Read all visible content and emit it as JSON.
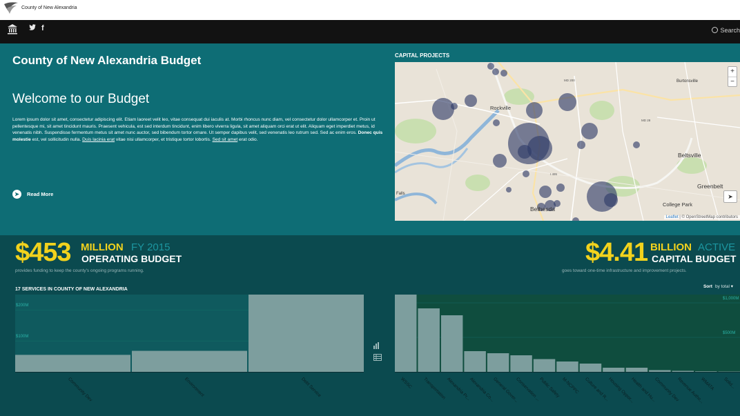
{
  "site": {
    "title": "County of New Alexandria"
  },
  "nav": {
    "search_label": "Search"
  },
  "hero": {
    "page_title": "County of New Alexandria Budget",
    "welcome": "Welcome to our Budget",
    "intro_part1": "Lorem ipsum dolor sit amet, consectetur adipiscing elit. Etiam laoreet velit leo, vitae consequat dui iaculis at. Morbi rhoncus nunc diam, vel consectetur dolor ullamcorper et. Proin ut pellentesque mi, sit amet tincidunt mauris. Praesent vehicula, est sed interdum tincidunt, enim libero viverra ligula, sit amet aliquam orci erat ut elit. Aliquam eget imperdiet metus, id venenatis nibh. Suspendisse fermentum metus sit amet nunc auctor, sed bibendum tortor ornare. Ut semper dapibus velit, sed venenatis leo rutrum sed. Sed ac enim eros. ",
    "intro_bold": "Donec quis molestie",
    "intro_part2": " est, vel sollicitudin nulla. ",
    "intro_link1": "Duis lacinia erat",
    "intro_part3": " vitae nisi ullamcorper, et tristique tortor lobortis. ",
    "intro_link2": "Sed sit amet",
    "intro_part4": " erat odio.",
    "read_more": "Read More"
  },
  "map": {
    "heading": "CAPITAL PROJECTS",
    "places": [
      "Rockville",
      "Burtonsville",
      "Beltsville",
      "Greenbelt",
      "Bethesda",
      "College Park",
      "Falls"
    ],
    "roads": [
      "MD 200",
      "MD 28",
      "I 495"
    ],
    "attribution_leaflet": "Leaflet",
    "attribution_rest": " | © OpenStreetMap contributors"
  },
  "operating": {
    "amount": "$453",
    "unit": "MILLION",
    "period": "FY 2015",
    "label": "OPERATING BUDGET",
    "description": "provides funding to keep the county's ongoing programs running."
  },
  "capital": {
    "amount": "$4.41",
    "unit": "BILLION",
    "period": "ACTIVE",
    "label": "CAPITAL BUDGET",
    "description": "goes toward one-time infrastructure and improvement projects."
  },
  "services": {
    "title": "17 SERVICES IN COUNTY OF NEW ALEXANDRIA"
  },
  "sort": {
    "label": "Sort",
    "value": "by total"
  },
  "colors": {
    "teal_hero": "#0e6d75",
    "teal_dark": "#0b4a4f",
    "yellow": "#f2d21d",
    "bar": "#7d9e9e"
  },
  "chart_data": [
    {
      "type": "bar",
      "title": "17 SERVICES IN COUNTY OF NEW ALEXANDRIA",
      "categories": [
        "Community Dev",
        "Environment",
        "Debt Service"
      ],
      "values": [
        55,
        68,
        250
      ],
      "ytick_labels": [
        "$100M",
        "$200M"
      ],
      "ylim": [
        0,
        250
      ]
    },
    {
      "type": "bar",
      "categories": [
        "WSSC",
        "Transportation",
        "Alexandria Pr...",
        "Alexandria Co...",
        "General Gover...",
        "Conservation ...",
        "Public Safety",
        "M-NCPPC",
        "Culture and R...",
        "Housing Oppor...",
        "Health and Hu...",
        "Community Dev",
        "Revenue Autho...",
        "WMATA",
        "Solid..."
      ],
      "values": [
        1120,
        920,
        820,
        300,
        270,
        240,
        185,
        150,
        120,
        60,
        60,
        25,
        15,
        8,
        5
      ],
      "ytick_labels": [
        "$500M",
        "$1,000M"
      ],
      "ylim": [
        0,
        1120
      ]
    }
  ]
}
